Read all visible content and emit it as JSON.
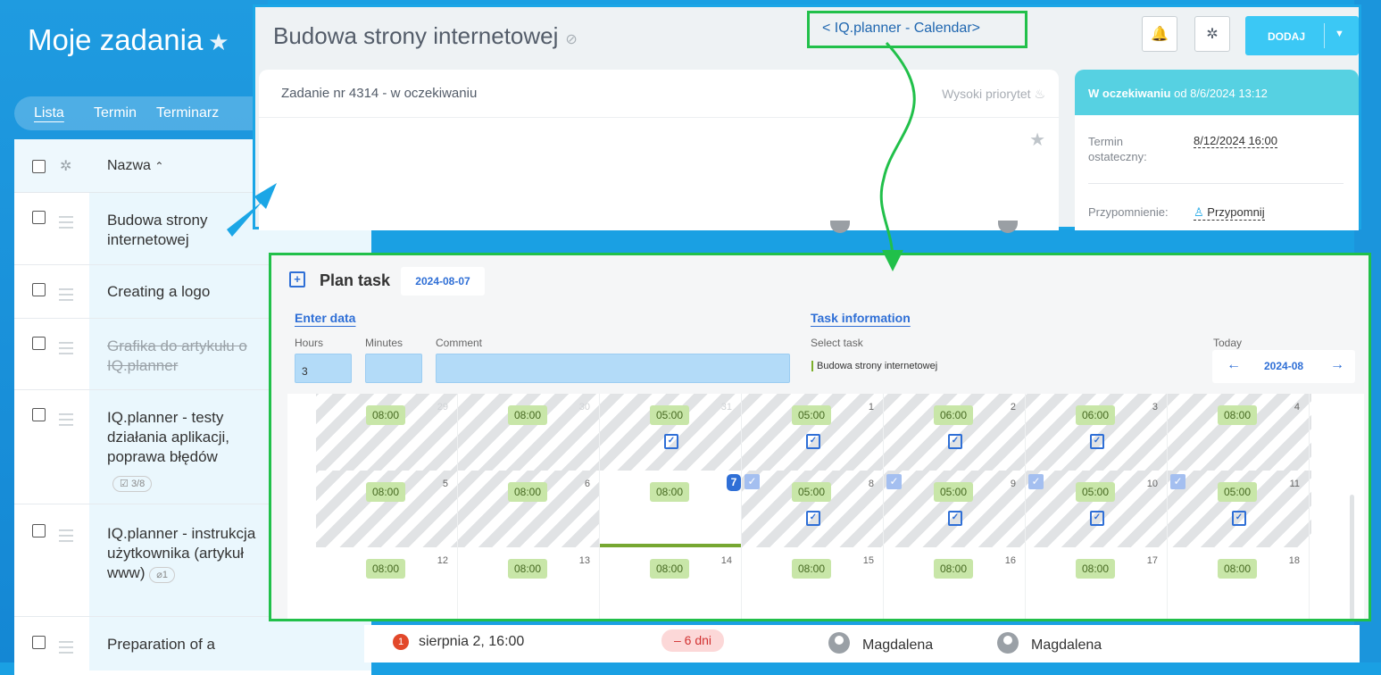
{
  "sidebar": {
    "title": "Moje zadania",
    "tabs": [
      "Lista",
      "Termin",
      "Terminarz"
    ],
    "column_name": "Nazwa",
    "rows": [
      {
        "name": "Budowa strony internetowej"
      },
      {
        "name": "Creating a logo"
      },
      {
        "name": "Grafika do artykułu o IQ.planner",
        "completed": true
      },
      {
        "name": "IQ.planner - testy działania aplikacji, poprawa błędów",
        "checklist": "3/8"
      },
      {
        "name": "IQ.planner - instrukcja użytkownika (artykuł www)",
        "attachments": "1"
      },
      {
        "name": "Preparation of a"
      }
    ]
  },
  "bottom_row": {
    "badge": "1",
    "deadline": "sierpnia 2, 16:00",
    "late": "– 6 dni",
    "responsible": "Magdalena",
    "creator": "Magdalena"
  },
  "task": {
    "title": "Budowa strony internetowej",
    "iq_link": "< IQ.planner - Calendar>",
    "add_label": "DODAJ",
    "subtitle": "Zadanie nr 4314 - w oczekiwaniu",
    "priority": "Wysoki priorytet",
    "status_word": "W oczekiwaniu",
    "status_rest": "od 8/6/2024 13:12",
    "deadline_label": "Termin ostateczny:",
    "deadline_value": "8/12/2024 16:00",
    "reminder_label": "Przypomnienie:",
    "reminder_value": "Przypomnij"
  },
  "plan": {
    "title": "Plan task",
    "date": "2024-08-07",
    "enter_data": "Enter data",
    "task_information": "Task information",
    "hours_label": "Hours",
    "minutes_label": "Minutes",
    "comment_label": "Comment",
    "hours_value": "3",
    "select_task_label": "Select task",
    "selected_task": "Budowa strony internetowej",
    "today_label": "Today",
    "month": "2024-08",
    "weeks": [
      [
        {
          "d": "29",
          "t": "08:00",
          "dim": true
        },
        {
          "d": "30",
          "t": "08:00",
          "dim": true
        },
        {
          "d": "31",
          "t": "05:00",
          "dim": true,
          "done": true
        },
        {
          "d": "1",
          "t": "05:00",
          "done": true
        },
        {
          "d": "2",
          "t": "06:00",
          "done": true
        },
        {
          "d": "3",
          "t": "06:00",
          "done": true
        },
        {
          "d": "4",
          "t": "08:00"
        }
      ],
      [
        {
          "d": "5",
          "t": "08:00"
        },
        {
          "d": "6",
          "t": "08:00"
        },
        {
          "d": "7",
          "t": "08:00",
          "today": true,
          "chk": true
        },
        {
          "d": "8",
          "t": "05:00",
          "done": true,
          "chk": true
        },
        {
          "d": "9",
          "t": "05:00",
          "done": true,
          "chk": true
        },
        {
          "d": "10",
          "t": "05:00",
          "done": true,
          "chk": true
        },
        {
          "d": "11",
          "t": "05:00",
          "done": true
        }
      ],
      [
        {
          "d": "12",
          "t": "08:00"
        },
        {
          "d": "13",
          "t": "08:00"
        },
        {
          "d": "14",
          "t": "08:00"
        },
        {
          "d": "15",
          "t": "08:00"
        },
        {
          "d": "16",
          "t": "08:00"
        },
        {
          "d": "17",
          "t": "08:00"
        },
        {
          "d": "18",
          "t": "08:00"
        }
      ]
    ]
  },
  "colors": {
    "accent_blue": "#1ba6e6",
    "highlight_green": "#21c04a",
    "time_chip": "#c8e6a8",
    "status_head": "#56d1e2"
  }
}
